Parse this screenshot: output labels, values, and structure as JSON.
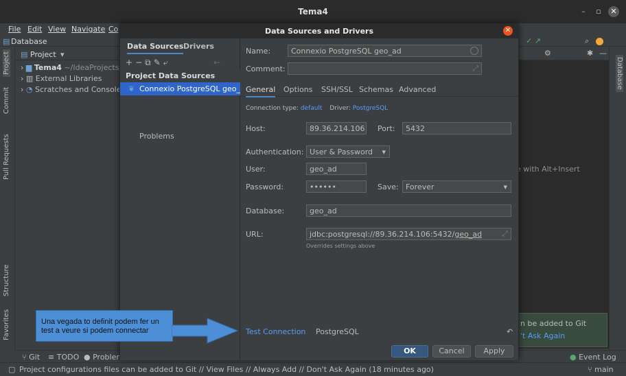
{
  "window": {
    "title": "Tema4"
  },
  "menu": [
    "File",
    "Edit",
    "View",
    "Navigate",
    "Co"
  ],
  "nav": {
    "database_label": "Database"
  },
  "project_panel": {
    "header": "Project",
    "items": [
      {
        "name": "Tema4",
        "path": "~/IdeaProjects/"
      },
      {
        "name": "External Libraries"
      },
      {
        "name": "Scratches and Consoles"
      }
    ]
  },
  "left_stripe": [
    "Project",
    "Commit",
    "Pull Requests",
    "Structure",
    "Favorites"
  ],
  "right_stripe": [
    "Database"
  ],
  "editor": {
    "hint": "e with Alt+Insert"
  },
  "git_notification": {
    "line1": "n be added to Git",
    "line2": "'t Ask Again"
  },
  "dialog": {
    "title": "Data Sources and Drivers",
    "left_tabs": [
      "Data Sources",
      "Drivers"
    ],
    "section_header": "Project Data Sources",
    "selected_source": "Connexio PostgreSQL geo_ac",
    "problems": "Problems",
    "name_label": "Name:",
    "name_value": "Connexio PostgreSQL geo_ad",
    "comment_label": "Comment:",
    "tabs": [
      "General",
      "Options",
      "SSH/SSL",
      "Schemas",
      "Advanced"
    ],
    "connection_type_label": "Connection type:",
    "connection_type_value": "default",
    "driver_label": "Driver:",
    "driver_value": "PostgreSQL",
    "host_label": "Host:",
    "host_value": "89.36.214.106",
    "port_label": "Port:",
    "port_value": "5432",
    "auth_label": "Authentication:",
    "auth_value": "User & Password",
    "user_label": "User:",
    "user_value": "geo_ad",
    "password_label": "Password:",
    "password_value": "••••••",
    "save_label": "Save:",
    "save_value": "Forever",
    "database_label": "Database:",
    "database_value": "geo_ad",
    "url_label": "URL:",
    "url_value_prefix": "jdbc:postgresql://89.36.214.106:5432/",
    "url_value_db": "geo_ad",
    "url_hint": "Overrides settings above",
    "test_connection": "Test Connection",
    "driver_footer": "PostgreSQL",
    "ok": "OK",
    "cancel": "Cancel",
    "apply": "Apply"
  },
  "bottom_tools": [
    "Git",
    "TODO",
    "Problems"
  ],
  "event_log": "Event Log",
  "status": {
    "message": "Project configurations files can be added to Git // View Files // Always Add // Don't Ask Again (18 minutes ago)",
    "branch": "main"
  },
  "annotation": {
    "text": "Una vegada to definit podem fer un test a veure si podem connectar"
  },
  "colors": {
    "accent": "#589df6",
    "selection": "#2f65ca",
    "close_button": "#e95420",
    "callout": "#4d8fd6",
    "primary_button": "#365880"
  }
}
